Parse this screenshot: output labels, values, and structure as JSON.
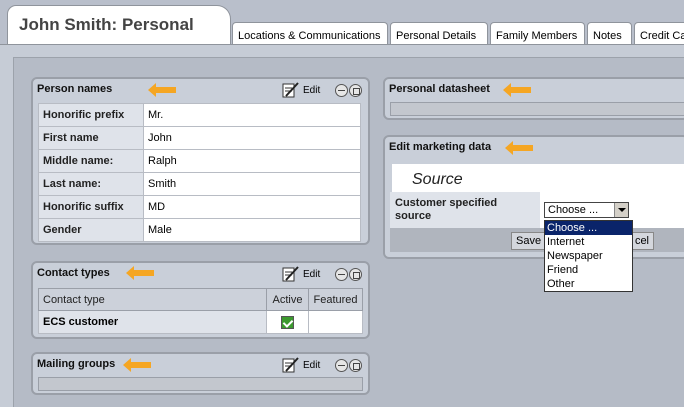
{
  "title": "John Smith: Personal",
  "tabs": [
    {
      "label": "Locations & Communications"
    },
    {
      "label": "Personal Details"
    },
    {
      "label": "Family Members"
    },
    {
      "label": "Notes"
    },
    {
      "label": "Credit Card"
    }
  ],
  "person_names": {
    "title": "Person names",
    "edit_label": "Edit",
    "rows": [
      {
        "label": "Honorific prefix",
        "value": "Mr."
      },
      {
        "label": "First name",
        "value": "John"
      },
      {
        "label": "Middle name:",
        "value": "Ralph"
      },
      {
        "label": "Last name:",
        "value": "Smith"
      },
      {
        "label": "Honorific suffix",
        "value": "MD"
      },
      {
        "label": "Gender",
        "value": "Male"
      }
    ]
  },
  "contact_types": {
    "title": "Contact types",
    "edit_label": "Edit",
    "headers": [
      "Contact type",
      "Active",
      "Featured"
    ],
    "rows": [
      {
        "type": "ECS customer",
        "active": true,
        "featured": false
      }
    ]
  },
  "mailing_groups": {
    "title": "Mailing groups",
    "edit_label": "Edit"
  },
  "personal_datasheet": {
    "title": "Personal datasheet"
  },
  "marketing": {
    "title": "Edit marketing data",
    "section_title": "Source",
    "field_label": "Customer specified source",
    "selected": "Choose ...",
    "options": [
      "Choose ...",
      "Internet",
      "Newspaper",
      "Friend",
      "Other"
    ],
    "save_label": "Save",
    "cancel_label": "cel"
  },
  "colors": {
    "accent_arrow": "#f5a623",
    "selection": "#0a246a",
    "check": "#3c9a2e"
  },
  "icons": {
    "arrow": "arrow-left-icon",
    "edit": "edit-icon",
    "minimize": "minimize-icon",
    "restore": "restore-icon",
    "check": "checkbox-checked-icon"
  }
}
